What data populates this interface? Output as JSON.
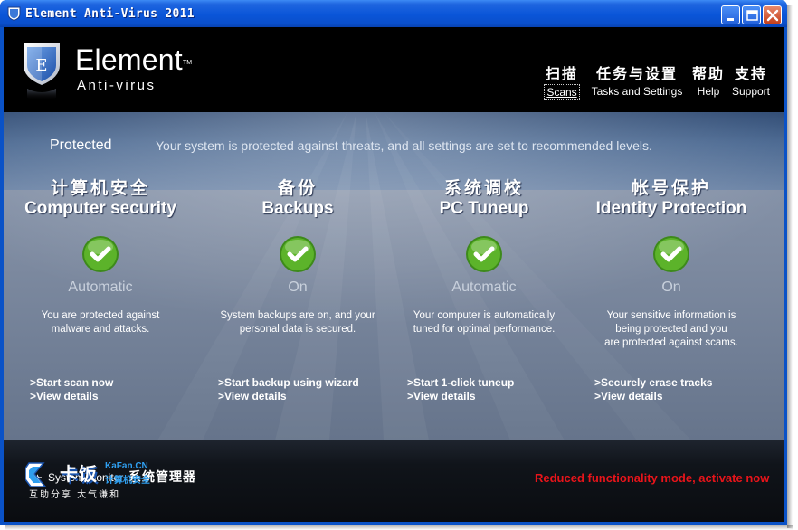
{
  "window": {
    "title": "Element Anti-Virus 2011"
  },
  "brand": {
    "name": "Element",
    "trademark": "TM",
    "product": "Anti-virus",
    "shield_letter": "E"
  },
  "nav": [
    {
      "cn": "扫描",
      "en": "Scans",
      "active": true
    },
    {
      "cn": "任务与设置",
      "en": "Tasks and Settings",
      "active": false
    },
    {
      "cn": "帮助",
      "en": "Help",
      "active": false
    },
    {
      "cn": "支持",
      "en": "Support",
      "active": false
    }
  ],
  "status": {
    "label": "Protected",
    "description": "Your system is protected against threats, and all settings are set to recommended levels."
  },
  "sections": [
    {
      "cn": "计算机安全",
      "en": "Computer security",
      "mode": "Automatic",
      "desc": "You are protected against\nmalware and attacks.",
      "links": [
        ">Start scan now",
        ">View details"
      ]
    },
    {
      "cn": "备份",
      "en": "Backups",
      "mode": "On",
      "desc": "System backups are on, and your\npersonal data is secured.",
      "links": [
        ">Start backup using wizard",
        ">View details"
      ]
    },
    {
      "cn": "系统调校",
      "en": "PC Tuneup",
      "mode": "Automatic",
      "desc": "Your computer is automatically\ntuned for optimal performance.",
      "links": [
        ">Start 1-click tuneup",
        ">View details"
      ]
    },
    {
      "cn": "帐号保护",
      "en": "Identity Protection",
      "mode": "On",
      "desc": "Your sensitive information is\nbeing protected and you\nare protected against scams.",
      "links": [
        ">Securely erase tracks",
        ">View details"
      ]
    }
  ],
  "footer": {
    "system_monitor_en": "System monitor",
    "system_monitor_cn": "系统管理器",
    "reduced_mode": "Reduced functionality mode, activate now"
  },
  "watermark": {
    "logo_text": "卡饭",
    "site": "KaFan.CN",
    "site_cn": "计算机安全",
    "slogan": "互助分享  大气谦和"
  },
  "colors": {
    "title_bar": "#0a55d8",
    "check_green": "#5cb32a",
    "warning_red": "#e8141a",
    "watermark_blue": "#2f9ff0"
  }
}
